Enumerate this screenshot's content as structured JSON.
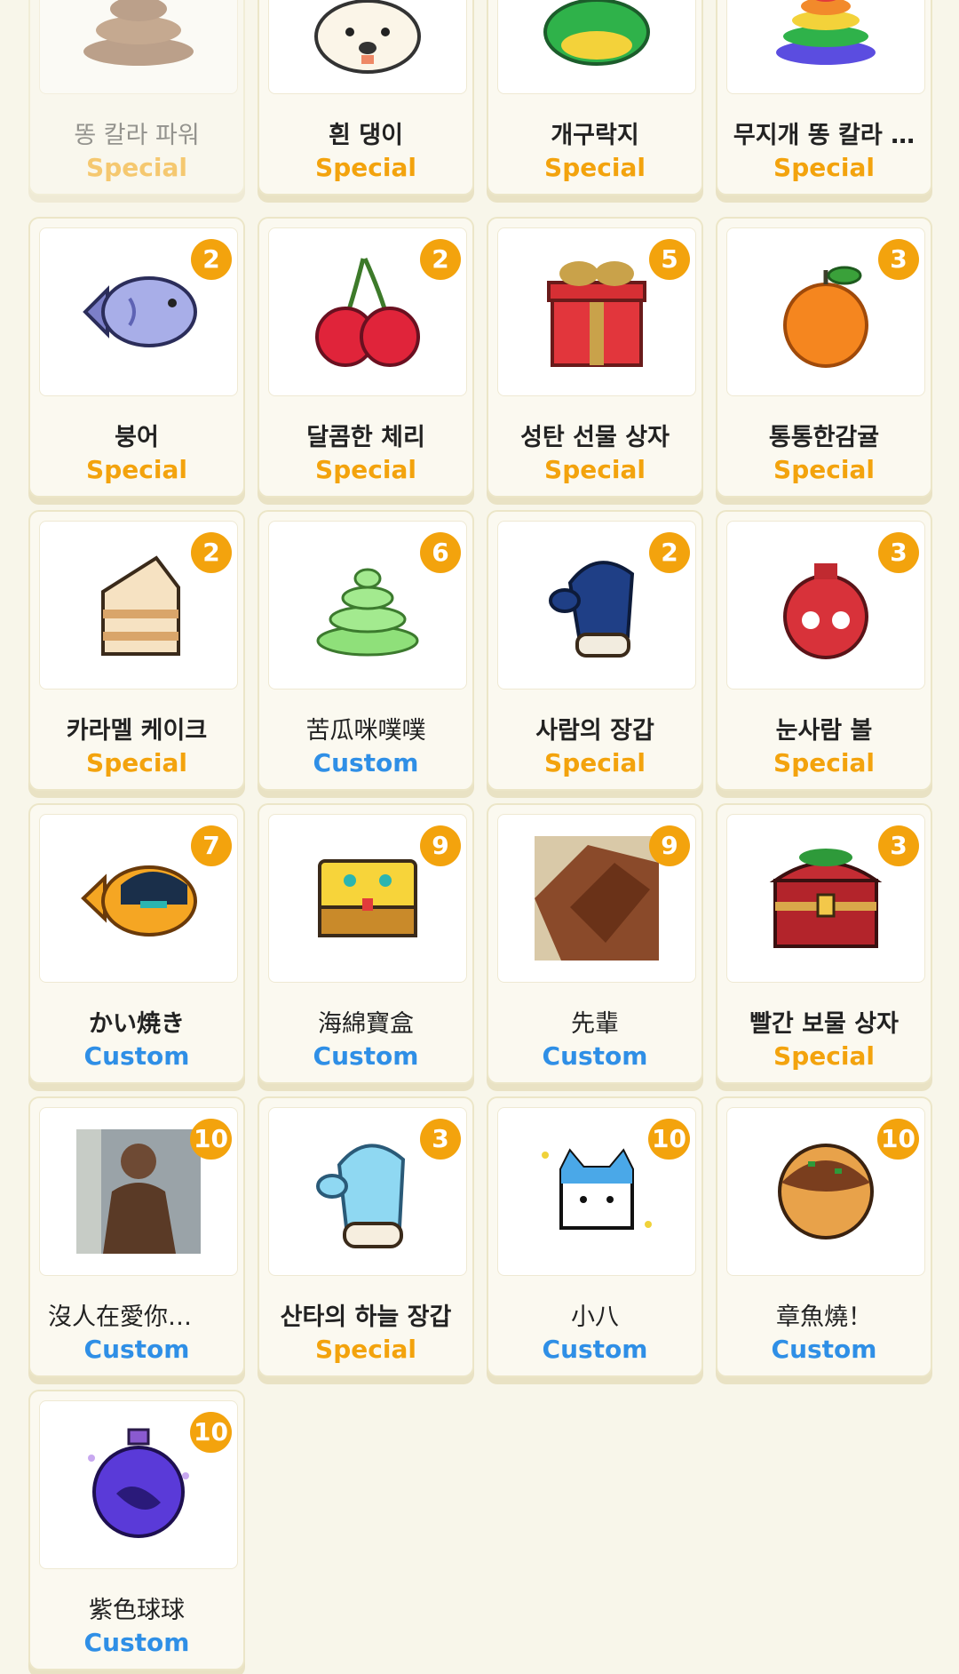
{
  "colors": {
    "special": "#f3a30d",
    "custom": "#2f8fe6",
    "badge": "#f3a30d",
    "background": "#f8f6ea"
  },
  "items": [
    {
      "name": "똥 칼라 파워",
      "type": "Special",
      "badge": "",
      "icon": "brown-poop-icon"
    },
    {
      "name": "흰 댕이",
      "type": "Special",
      "badge": "",
      "icon": "white-dog-icon"
    },
    {
      "name": "개구락지",
      "type": "Special",
      "badge": "",
      "icon": "frog-icon"
    },
    {
      "name": "무지개 똥 칼라 …",
      "type": "Special",
      "badge": "",
      "icon": "rainbow-poop-icon"
    },
    {
      "name": "붕어",
      "type": "Special",
      "badge": "2",
      "icon": "fish-bread-icon"
    },
    {
      "name": "달콤한 체리",
      "type": "Special",
      "badge": "2",
      "icon": "cherry-icon"
    },
    {
      "name": "성탄 선물 상자",
      "type": "Special",
      "badge": "5",
      "icon": "gift-box-icon"
    },
    {
      "name": "통통한감귤",
      "type": "Special",
      "badge": "3",
      "icon": "tangerine-icon"
    },
    {
      "name": "카라멜 케이크",
      "type": "Special",
      "badge": "2",
      "icon": "cake-icon"
    },
    {
      "name": "苦瓜咪噗噗",
      "type": "Custom",
      "badge": "6",
      "icon": "green-swirl-icon"
    },
    {
      "name": "사람의 장갑",
      "type": "Special",
      "badge": "2",
      "icon": "navy-mitten-icon"
    },
    {
      "name": "눈사람 볼",
      "type": "Special",
      "badge": "3",
      "icon": "snowman-ornament-icon"
    },
    {
      "name": "かい焼き",
      "type": "Custom",
      "badge": "7",
      "icon": "anime-taiyaki-icon"
    },
    {
      "name": "海綿寶盒",
      "type": "Custom",
      "badge": "9",
      "icon": "sponge-box-icon"
    },
    {
      "name": "先輩",
      "type": "Custom",
      "badge": "9",
      "icon": "photo-senpai-icon"
    },
    {
      "name": "빨간 보물 상자",
      "type": "Special",
      "badge": "3",
      "icon": "treasure-chest-icon"
    },
    {
      "name": "沒人在愛你…",
      "type": "Custom",
      "badge": "10",
      "icon": "photo-person-icon"
    },
    {
      "name": "산타의 하늘 장갑",
      "type": "Special",
      "badge": "3",
      "icon": "sky-mitten-icon"
    },
    {
      "name": "小八",
      "type": "Custom",
      "badge": "10",
      "icon": "cat-face-icon"
    },
    {
      "name": "章魚燒！",
      "type": "Custom",
      "badge": "10",
      "icon": "takoyaki-icon"
    },
    {
      "name": "紫色球球",
      "type": "Custom",
      "badge": "10",
      "icon": "purple-ornament-icon"
    }
  ]
}
